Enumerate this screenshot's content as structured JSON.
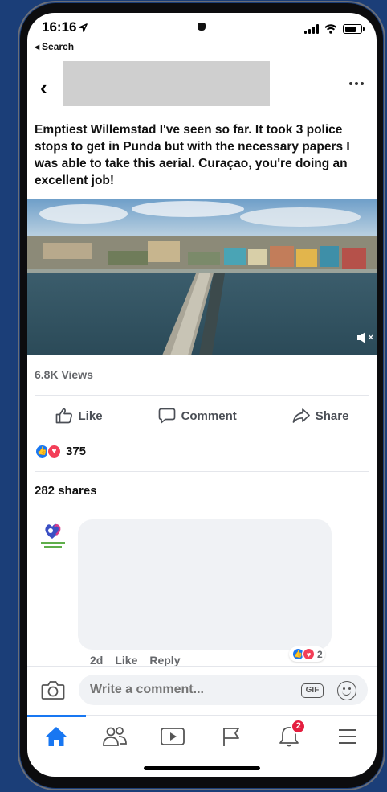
{
  "status_bar": {
    "time": "16:16",
    "back_app": "Search"
  },
  "post": {
    "text": "Emptiest Willemstad I've seen so far. It took 3 police stops to get in Punda but with the necessary papers I was able to take this aerial. Curaçao, you're doing an excellent job!",
    "views": "6.8K Views",
    "reaction_count": "375",
    "shares": "282 shares"
  },
  "actions": {
    "like": "Like",
    "comment": "Comment",
    "share": "Share"
  },
  "comment": {
    "age": "2d",
    "like": "Like",
    "reply": "Reply",
    "reaction_count": "2"
  },
  "composer": {
    "placeholder": "Write a comment...",
    "gif": "GIF"
  },
  "tabbar": {
    "notifications_badge": "2"
  },
  "colors": {
    "accent": "#1877f2",
    "love": "#f33e58",
    "badge": "#e41e3f",
    "background": "#1b3e78"
  }
}
